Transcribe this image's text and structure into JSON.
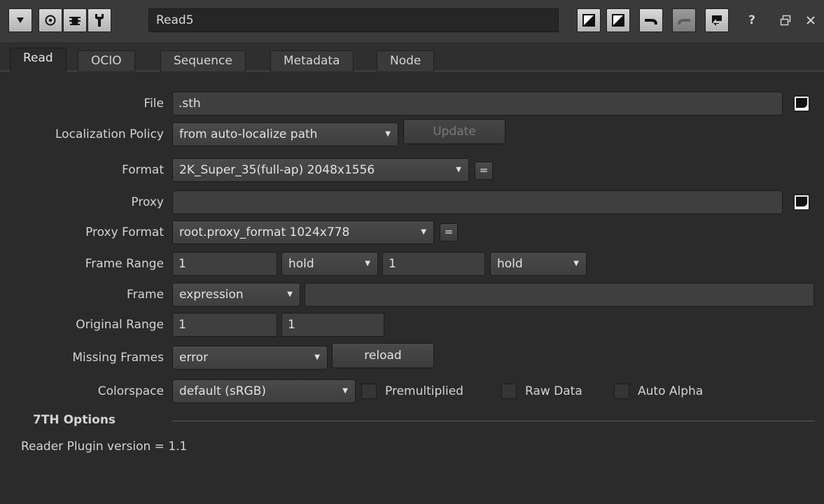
{
  "node": {
    "name": "Read5"
  },
  "titlebar": {
    "help_label": "?",
    "icons": [
      "collapse-arrow-icon",
      "center-node-icon",
      "bug-icon",
      "wrench-icon",
      "input-toggle-icon",
      "output-toggle-icon",
      "undo-icon",
      "redo-icon",
      "revert-icon",
      "help-icon",
      "float-icon",
      "close-icon"
    ]
  },
  "tabs": [
    {
      "label": "Read",
      "active": true
    },
    {
      "label": "OCIO"
    },
    {
      "label": "Sequence"
    },
    {
      "label": "Metadata"
    },
    {
      "label": "Node"
    }
  ],
  "form": {
    "file": {
      "label": "File",
      "value": ".sth"
    },
    "localization": {
      "label": "Localization Policy",
      "value": "from auto-localize path",
      "button": "Update"
    },
    "format": {
      "label": "Format",
      "value": "2K_Super_35(full-ap) 2048x1556",
      "eq": "="
    },
    "proxy": {
      "label": "Proxy",
      "value": ""
    },
    "proxy_format": {
      "label": "Proxy Format",
      "value": "root.proxy_format 1024x778",
      "eq": "="
    },
    "frame_range": {
      "label": "Frame Range",
      "first": "1",
      "before": "hold",
      "last": "1",
      "after": "hold"
    },
    "frame": {
      "label": "Frame",
      "mode": "expression",
      "value": ""
    },
    "original_range": {
      "label": "Original Range",
      "first": "1",
      "last": "1"
    },
    "missing_frames": {
      "label": "Missing Frames",
      "value": "error",
      "button": "reload"
    },
    "colorspace": {
      "label": "Colorspace",
      "value": "default (sRGB)",
      "premult": "Premultiplied",
      "raw": "Raw Data",
      "auto_alpha": "Auto Alpha"
    }
  },
  "section": {
    "title": "7TH Options",
    "info": "Reader Plugin version = 1.1"
  }
}
